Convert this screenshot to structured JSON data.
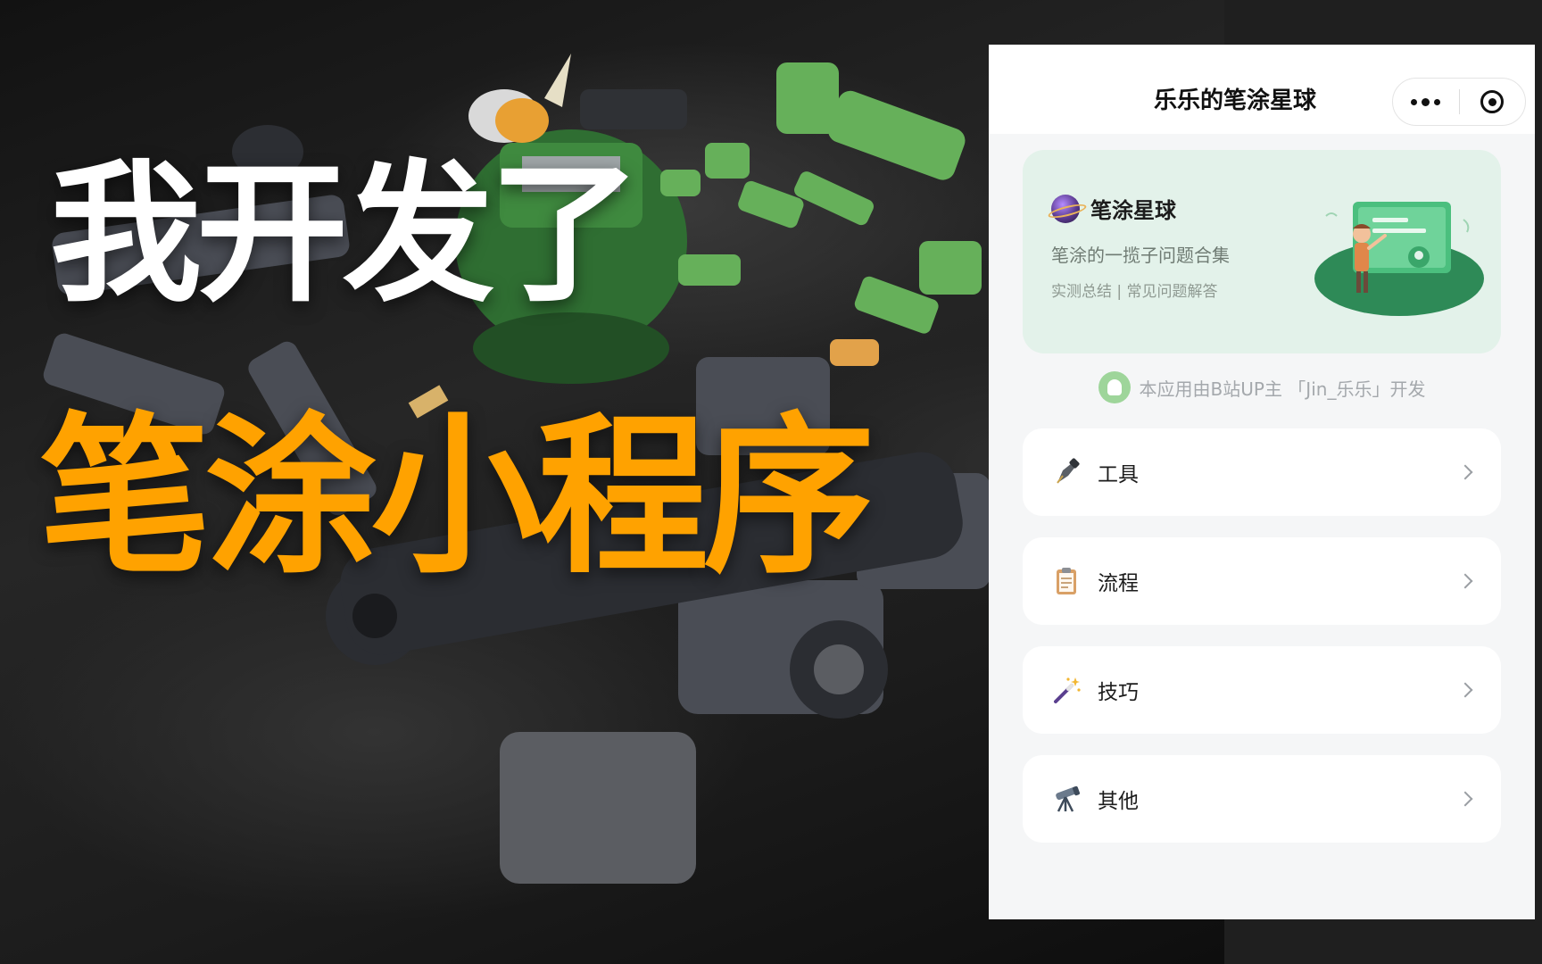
{
  "headline": {
    "line1": "我开发了",
    "line2": "笔涂小程序"
  },
  "miniprogram": {
    "nav_title": "乐乐的笔涂星球",
    "capsule": {
      "more_icon": "more-dots-icon",
      "close_icon": "target-icon"
    },
    "banner": {
      "icon": "planet-icon",
      "title": "笔涂星球",
      "subtitle": "笔涂的一揽子问题合集",
      "tags": "实测总结 | 常见问题解答"
    },
    "credit": "本应用由B站UP主 「Jin_乐乐」开发",
    "menu": [
      {
        "label": "工具",
        "icon": "fountain-pen-icon"
      },
      {
        "label": "流程",
        "icon": "clipboard-icon"
      },
      {
        "label": "技巧",
        "icon": "magic-wand-icon"
      },
      {
        "label": "其他",
        "icon": "telescope-icon"
      }
    ]
  },
  "colors": {
    "headline_accent": "#ffa200",
    "banner_bg": "#e3f2ea",
    "banner_art_green": "#2e8a57"
  }
}
